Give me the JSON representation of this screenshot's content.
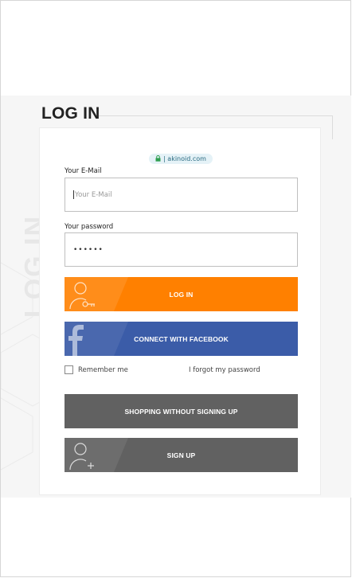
{
  "page": {
    "title": "LOG IN",
    "vertical_watermark": "LOG IN",
    "url_badge": "| akinoid.com"
  },
  "form": {
    "email_label": "Your E-Mail",
    "email_placeholder": "Your E-Mail",
    "password_label": "Your password",
    "password_value": "••••••"
  },
  "buttons": {
    "login": "LOG IN",
    "facebook": "CONNECT WITH FACEBOOK",
    "guest": "SHOPPING WITHOUT SIGNING UP",
    "signup": "SIGN UP"
  },
  "options": {
    "remember_me": "Remember me",
    "remember_me_checked": false,
    "forgot_password": "I forgot my password"
  },
  "colors": {
    "login_button": "#ff8000",
    "facebook_button": "#3b5ca8",
    "grey_button": "#616161",
    "url_badge_bg": "#e5f2f7",
    "lock_icon": "#2e9e4f"
  },
  "icons": [
    "lock-icon",
    "user-key-icon",
    "facebook-f-icon",
    "user-plus-icon"
  ]
}
